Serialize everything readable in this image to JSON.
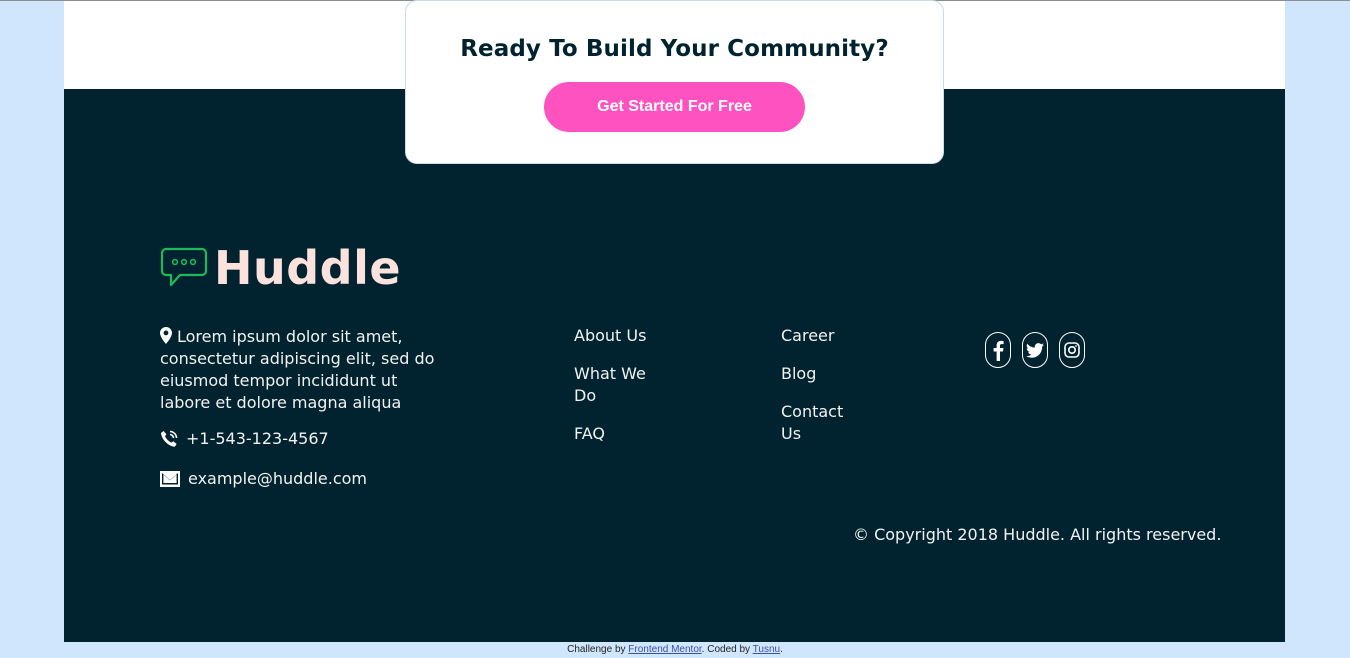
{
  "cta": {
    "title": "Ready To Build Your Community?",
    "button_label": "Get Started For Free"
  },
  "footer": {
    "logo_text": "Huddle",
    "address": "Lorem ipsum dolor sit amet, consectetur adipiscing elit, sed do eiusmod tempor incididunt ut labore et dolore magna aliqua",
    "phone": "+1-543-123-4567",
    "email": "example@huddle.com",
    "links_col1": [
      "About Us",
      "What We Do",
      "FAQ"
    ],
    "links_col2": [
      "Career",
      "Blog",
      "Contact Us"
    ],
    "socials": [
      "facebook-icon",
      "twitter-icon",
      "instagram-icon"
    ],
    "copyright": "© Copyright 2018 Huddle. All rights reserved."
  },
  "attribution": {
    "prefix": "Challenge by ",
    "link1": "Frontend Mentor",
    "middle": ". Coded by ",
    "link2": "Tusnu",
    "suffix": "."
  },
  "colors": {
    "footer_bg": "#00232f",
    "page_bg": "#d0e6fc",
    "cta_button": "#ff52c1",
    "logo_text": "#fce2dc",
    "logo_icon": "#1fb85a"
  }
}
